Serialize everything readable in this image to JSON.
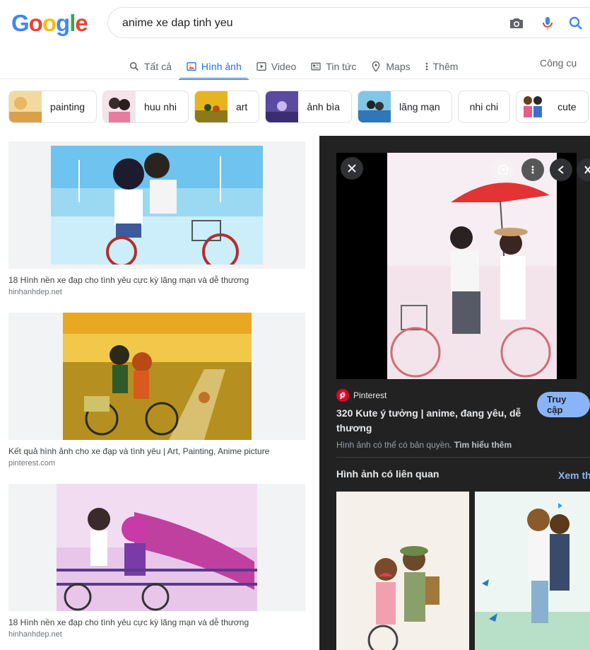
{
  "logo": [
    "G",
    "o",
    "o",
    "g",
    "l",
    "e"
  ],
  "search": {
    "query": "anime xe dap tinh yeu"
  },
  "tabs": [
    {
      "label": "Tất cả",
      "icon": "search-icon"
    },
    {
      "label": "Hình ảnh",
      "icon": "image-icon",
      "active": true
    },
    {
      "label": "Video",
      "icon": "video-icon"
    },
    {
      "label": "Tin tức",
      "icon": "news-icon"
    },
    {
      "label": "Maps",
      "icon": "map-pin-icon"
    },
    {
      "label": "Thêm",
      "icon": "more-vert-icon"
    }
  ],
  "tools_label": "Công cụ",
  "chips": [
    {
      "label": "painting"
    },
    {
      "label": "huu nhi"
    },
    {
      "label": "art"
    },
    {
      "label": "ảnh bìa"
    },
    {
      "label": "lãng mạn"
    },
    {
      "label": "nhi chi"
    },
    {
      "label": "cute"
    }
  ],
  "results": [
    {
      "title": "18 Hình nền xe đạp cho tình yêu cực kỳ lãng mạn và dễ thương",
      "source": "hinhanhdep.net"
    },
    {
      "title": "Kết quả hình ảnh cho xe đạp và tình yêu | Art, Painting, Anime picture",
      "source": "pinterest.com"
    },
    {
      "title": "18 Hình nền xe đạp cho tình yêu cực kỳ lãng mạn và dễ thương",
      "source": "hinhanhdep.net"
    }
  ],
  "panel": {
    "source_name": "Pinterest",
    "title": "320 Kute ý tưởng | anime, đang yêu, dễ thương",
    "visit_label": "Truy cập",
    "copyright_text": "Hình ảnh có thể có bản quyền.",
    "learn_more": "Tìm hiểu thêm",
    "related_heading": "Hình ảnh có liên quan",
    "see_more": "Xem thêm"
  },
  "colors": {
    "accent": "#1a73e8",
    "panel_bg": "#222222",
    "visit_bg": "#8ab4f8",
    "pinterest": "#e60023"
  }
}
